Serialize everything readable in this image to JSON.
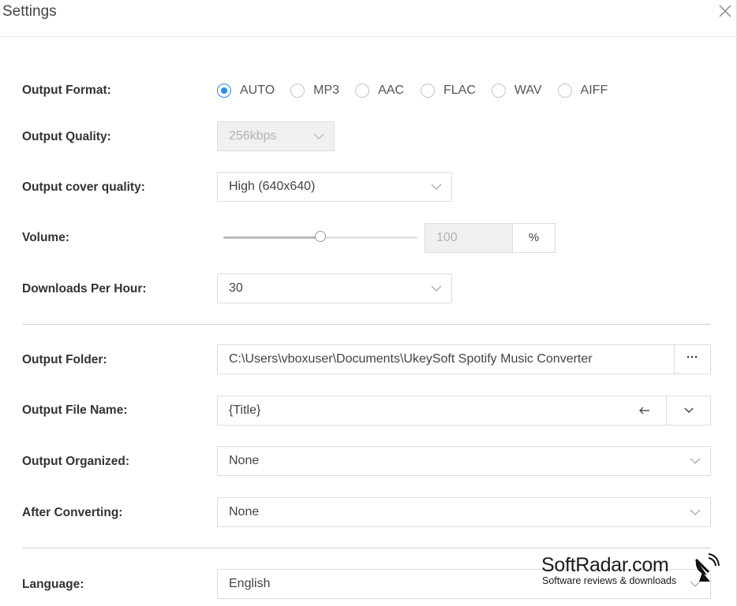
{
  "window": {
    "title": "Settings"
  },
  "output_format": {
    "label": "Output Format:",
    "options": [
      "AUTO",
      "MP3",
      "AAC",
      "FLAC",
      "WAV",
      "AIFF"
    ],
    "selected": "AUTO"
  },
  "output_quality": {
    "label": "Output Quality:",
    "value": "256kbps"
  },
  "cover_quality": {
    "label": "Output cover quality:",
    "value": "High (640x640)"
  },
  "volume": {
    "label": "Volume:",
    "value": "100",
    "unit": "%",
    "slider_fraction": 0.5
  },
  "downloads_per_hour": {
    "label": "Downloads Per Hour:",
    "value": "30"
  },
  "output_folder": {
    "label": "Output Folder:",
    "value": "C:\\Users\\vboxuser\\Documents\\UkeySoft Spotify Music Converter",
    "browse_label": "···"
  },
  "output_file_name": {
    "label": "Output File Name:",
    "value": "{Title}"
  },
  "output_organized": {
    "label": "Output Organized:",
    "value": "None"
  },
  "after_converting": {
    "label": "After Converting:",
    "value": "None"
  },
  "language": {
    "label": "Language:",
    "value": "English"
  },
  "watermark": {
    "title": "SoftRadar.com",
    "subtitle": "Software reviews & downloads"
  },
  "colors": {
    "accent": "#2e8cf0",
    "border": "#dcdcdc",
    "disabled_bg": "#f0f0f0"
  }
}
